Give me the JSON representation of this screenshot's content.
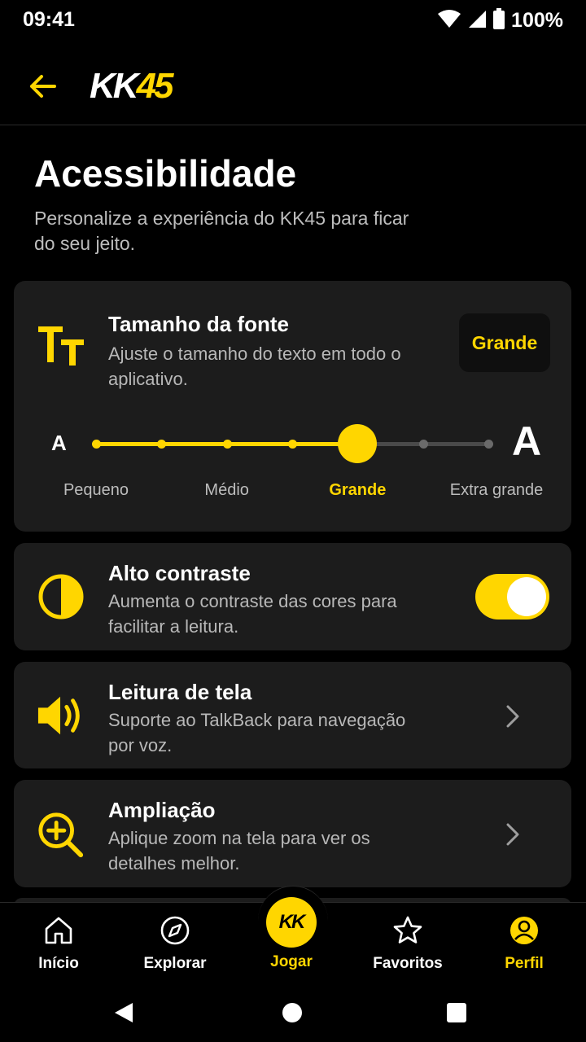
{
  "status_bar": {
    "time": "09:41",
    "battery": "100%"
  },
  "app_bar": {
    "logo_letters": "KK",
    "logo_number": "45"
  },
  "header": {
    "title": "Acessibilidade",
    "subtitle": "Personalize a experiência do KK45 para ficar do seu jeito."
  },
  "font_size": {
    "title": "Tamanho da fonte",
    "description": "Ajuste o tamanho do texto em todo o aplicativo.",
    "badge": "Grande",
    "small_a": "A",
    "big_a": "A",
    "levels": [
      "Pequeno",
      "Médio",
      "Grande",
      "Extra grande"
    ],
    "selected_step": 4,
    "total_steps": 7
  },
  "high_contrast": {
    "title": "Alto contraste",
    "description": "Aumenta o contraste das cores para facilitar a leitura.",
    "enabled": true
  },
  "screen_reader": {
    "title": "Leitura de tela",
    "description": "Suporte ao TalkBack para navegação por voz."
  },
  "magnification": {
    "title": "Ampliação",
    "description": "Aplique zoom na tela para ver os detalhes melhor."
  },
  "bottom_nav": {
    "home": "Início",
    "explore": "Explorar",
    "play": "Jogar",
    "play_logo": "KK",
    "favorites": "Favoritos",
    "profile": "Perfil"
  },
  "colors": {
    "accent": "#FFD600",
    "card": "#1c1c1c",
    "background": "#000000"
  }
}
